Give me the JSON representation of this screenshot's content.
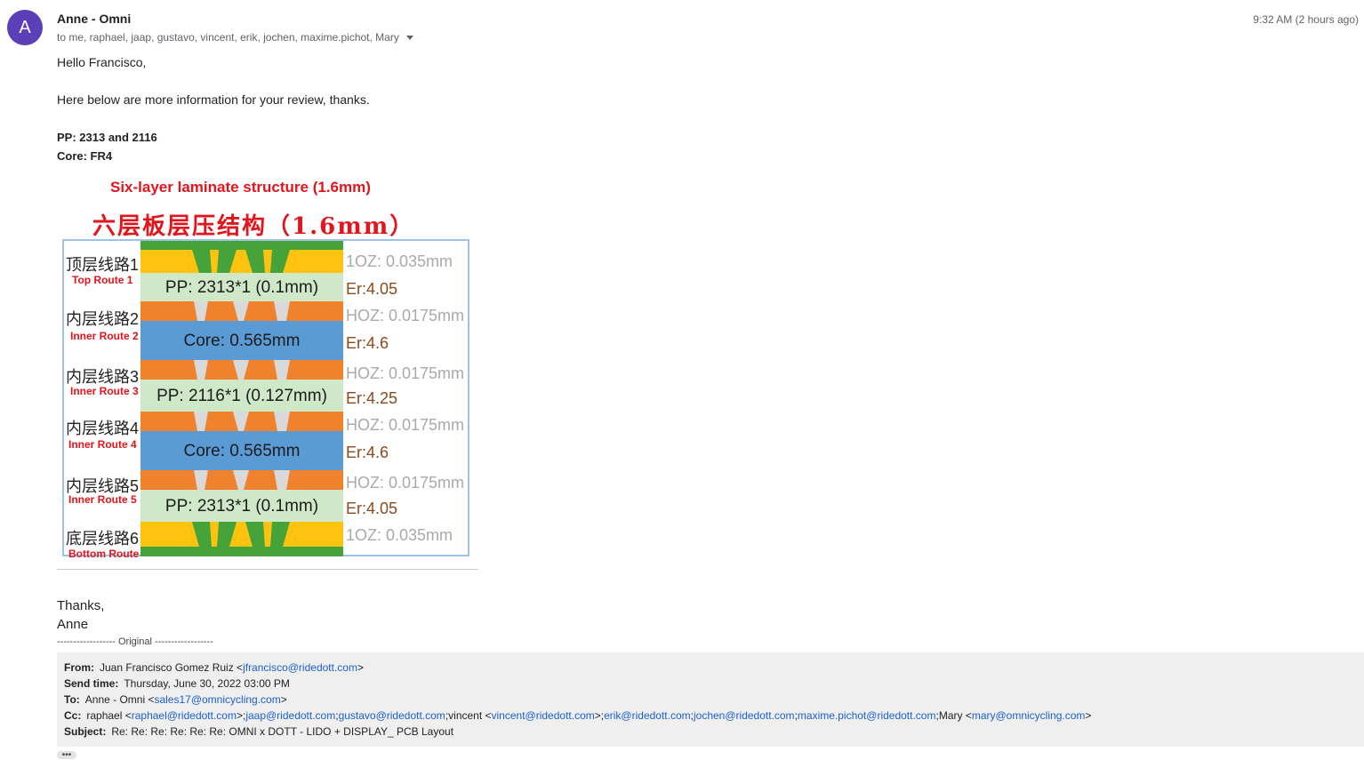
{
  "header": {
    "avatar_letter": "A",
    "sender": "Anne - Omni",
    "recipients": "to me, raphael, jaap, gustavo, vincent, erik, jochen, maxime.pichot, Mary",
    "time": "9:32 AM (2 hours ago)",
    "avatar_color": "#5a3fb8"
  },
  "body": {
    "greeting": "Hello Francisco,",
    "intro": "Here below are more information for your review, thanks.",
    "pp": "PP: 2313 and 2116",
    "core": "Core: FR4",
    "thanks": "Thanks,",
    "signature": "Anne",
    "original_sep": "------------------ Original ------------------"
  },
  "diagram": {
    "title_en": "Six-layer laminate structure (1.6mm)",
    "title_cn": "六层板层压结构（1.6mm）",
    "layers": [
      {
        "cn": "顶层线路1",
        "en": "Top Route 1",
        "spec": "1OZ: 0.035mm"
      },
      {
        "fill": "PP: 2313*1 (0.1mm)",
        "er": "Er:4.05"
      },
      {
        "cn": "内层线路2",
        "en": "Inner Route 2",
        "spec": "HOZ: 0.0175mm"
      },
      {
        "fill": "Core: 0.565mm",
        "er": "Er:4.6"
      },
      {
        "cn": "内层线路3",
        "en": "Inner Route 3",
        "spec": "HOZ: 0.0175mm"
      },
      {
        "fill": "PP: 2116*1 (0.127mm)",
        "er": "Er:4.25"
      },
      {
        "cn": "内层线路4",
        "en": "Inner Route 4",
        "spec": "HOZ: 0.0175mm"
      },
      {
        "fill": "Core: 0.565mm",
        "er": "Er:4.6"
      },
      {
        "cn": "内层线路5",
        "en": "Inner Route 5",
        "spec": "HOZ: 0.0175mm"
      },
      {
        "fill": "PP: 2313*1 (0.1mm)",
        "er": "Er:4.05"
      },
      {
        "cn": "底层线路6",
        "en": "Bottom Route",
        "spec": "1OZ: 0.035mm"
      }
    ]
  },
  "quoted": {
    "from_label": "From:",
    "from_name": "Juan Francisco Gomez Ruiz <",
    "from_email": "jfrancisco@ridedott.com",
    "from_end": ">",
    "send_label": "Send time:",
    "send_value": "Thursday, June 30, 2022 03:00 PM",
    "to_label": "To:",
    "to_name": "Anne - Omni <",
    "to_email": "sales17@omnicycling.com",
    "to_end": ">",
    "cc_label": "Cc:",
    "cc_1": "raphael <",
    "cc_1_email": "raphael@ridedott.com",
    "cc_2": ">;",
    "cc_jaap": "jaap@ridedott.com",
    "cc_semi1": ";",
    "cc_gustavo": "gustavo@ridedott.com",
    "cc_3": ";vincent <",
    "cc_vincent": "vincent@ridedott.com",
    "cc_4": ">;",
    "cc_erik": "erik@ridedott.com",
    "cc_semi2": ";",
    "cc_jochen": "jochen@ridedott.com",
    "cc_semi3": ";",
    "cc_maxime": "maxime.pichot@ridedott.com",
    "cc_5": ";Mary <",
    "cc_mary": "mary@omnicycling.com",
    "cc_6": ">",
    "subject_label": "Subject:",
    "subject_value": "Re: Re: Re: Re: Re: Re: OMNI x DOTT - LIDO + DISPLAY_ PCB Layout"
  },
  "more_button": "•••"
}
